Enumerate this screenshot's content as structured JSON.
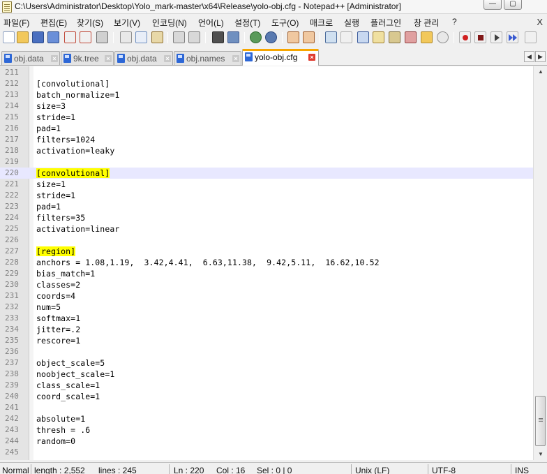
{
  "window": {
    "title": "C:\\Users\\Administrator\\Desktop\\Yolo_mark-master\\x64\\Release\\yolo-obj.cfg - Notepad++ [Administrator]",
    "minimize_glyph": "—",
    "maximize_glyph": "▢"
  },
  "menu": {
    "items": [
      "파일(F)",
      "편집(E)",
      "찾기(S)",
      "보기(V)",
      "인코딩(N)",
      "언어(L)",
      "설정(T)",
      "도구(O)",
      "매크로",
      "실행",
      "플러그인",
      "창 관리",
      "?"
    ],
    "close_glyph": "X"
  },
  "toolbar": {
    "icons": [
      "new-file",
      "open-file",
      "save",
      "save-all",
      "close",
      "close-all",
      "print",
      "cut",
      "copy",
      "paste",
      "undo",
      "redo",
      "find",
      "replace",
      "zoom-in",
      "zoom-out",
      "sync-vertical",
      "sync-horizontal",
      "word-wrap",
      "show-all-characters",
      "indent-guide",
      "user-defined-language",
      "document-map",
      "function-list",
      "folder-as-workspace",
      "monitoring",
      "record-macro",
      "stop-recording",
      "playback-macro",
      "run-macro-multiple",
      "save-macro"
    ]
  },
  "tabs": [
    {
      "label": "obj.data",
      "active": false
    },
    {
      "label": "9k.tree",
      "active": false
    },
    {
      "label": "obj.data",
      "active": false
    },
    {
      "label": "obj.names",
      "active": false
    },
    {
      "label": "yolo-obj.cfg",
      "active": true
    }
  ],
  "tab_scroll": {
    "left": "◀",
    "right": "▶"
  },
  "editor": {
    "current_line": 220,
    "lines": [
      {
        "n": "211",
        "text": ""
      },
      {
        "n": "212",
        "text": "[convolutional]"
      },
      {
        "n": "213",
        "text": "batch_normalize=1"
      },
      {
        "n": "214",
        "text": "size=3"
      },
      {
        "n": "215",
        "text": "stride=1"
      },
      {
        "n": "216",
        "text": "pad=1"
      },
      {
        "n": "217",
        "text": "filters=1024"
      },
      {
        "n": "218",
        "text": "activation=leaky"
      },
      {
        "n": "219",
        "text": ""
      },
      {
        "n": "220",
        "text": "[convolutional]",
        "highlight": true
      },
      {
        "n": "221",
        "text": "size=1"
      },
      {
        "n": "222",
        "text": "stride=1"
      },
      {
        "n": "223",
        "text": "pad=1"
      },
      {
        "n": "224",
        "text": "filters=35"
      },
      {
        "n": "225",
        "text": "activation=linear"
      },
      {
        "n": "226",
        "text": ""
      },
      {
        "n": "227",
        "text": "[region]",
        "highlight": true
      },
      {
        "n": "228",
        "text": "anchors = 1.08,1.19,  3.42,4.41,  6.63,11.38,  9.42,5.11,  16.62,10.52"
      },
      {
        "n": "229",
        "text": "bias_match=1"
      },
      {
        "n": "230",
        "text": "classes=2"
      },
      {
        "n": "231",
        "text": "coords=4"
      },
      {
        "n": "232",
        "text": "num=5"
      },
      {
        "n": "233",
        "text": "softmax=1"
      },
      {
        "n": "234",
        "text": "jitter=.2"
      },
      {
        "n": "235",
        "text": "rescore=1"
      },
      {
        "n": "236",
        "text": ""
      },
      {
        "n": "237",
        "text": "object_scale=5"
      },
      {
        "n": "238",
        "text": "noobject_scale=1"
      },
      {
        "n": "239",
        "text": "class_scale=1"
      },
      {
        "n": "240",
        "text": "coord_scale=1"
      },
      {
        "n": "241",
        "text": ""
      },
      {
        "n": "242",
        "text": "absolute=1"
      },
      {
        "n": "243",
        "text": "thresh = .6"
      },
      {
        "n": "244",
        "text": "random=0"
      },
      {
        "n": "245",
        "text": ""
      }
    ]
  },
  "scrollbar": {
    "up": "▲",
    "down": "▼",
    "position_fraction": 0.93
  },
  "status": {
    "mode": "Normal",
    "length": "length : 2,552",
    "lines": "lines : 245",
    "ln": "Ln : 220",
    "col": "Col : 16",
    "sel": "Sel : 0 | 0",
    "eol": "Unix (LF)",
    "encoding": "UTF-8",
    "ins": "INS"
  },
  "colors": {
    "highlight": "#ffff00",
    "current_line": "#e8e8ff",
    "active_tab_accent": "#f7a600",
    "tab_close_active": "#e03b2e"
  }
}
